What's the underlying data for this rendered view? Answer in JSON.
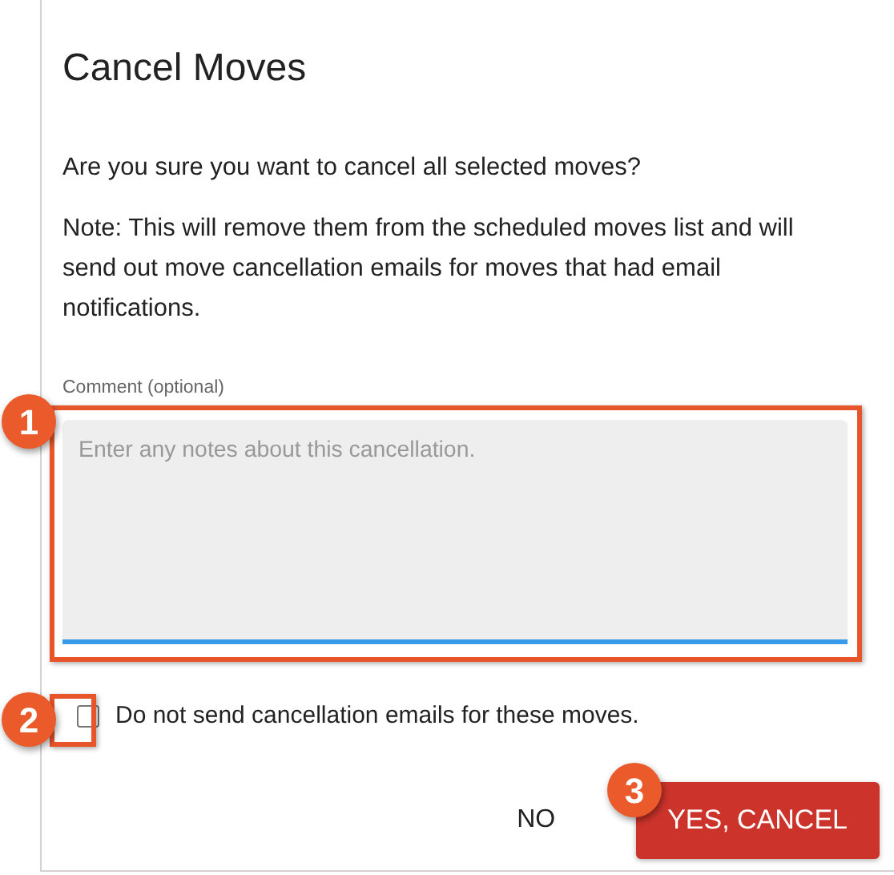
{
  "dialog": {
    "title": "Cancel Moves",
    "question": "Are you sure you want to cancel all selected moves?",
    "note": "Note: This will remove them from the scheduled moves list and will send out move cancellation emails for moves that had email notifications.",
    "comment": {
      "label": "Comment (optional)",
      "placeholder": "Enter any notes about this cancellation."
    },
    "checkbox": {
      "label": "Do not send cancellation emails for these moves.",
      "checked": false
    },
    "buttons": [
      {
        "label": "NO",
        "kind": "text"
      },
      {
        "label": "YES, CANCEL",
        "kind": "danger"
      }
    ]
  },
  "callouts": [
    "1",
    "2",
    "3"
  ]
}
